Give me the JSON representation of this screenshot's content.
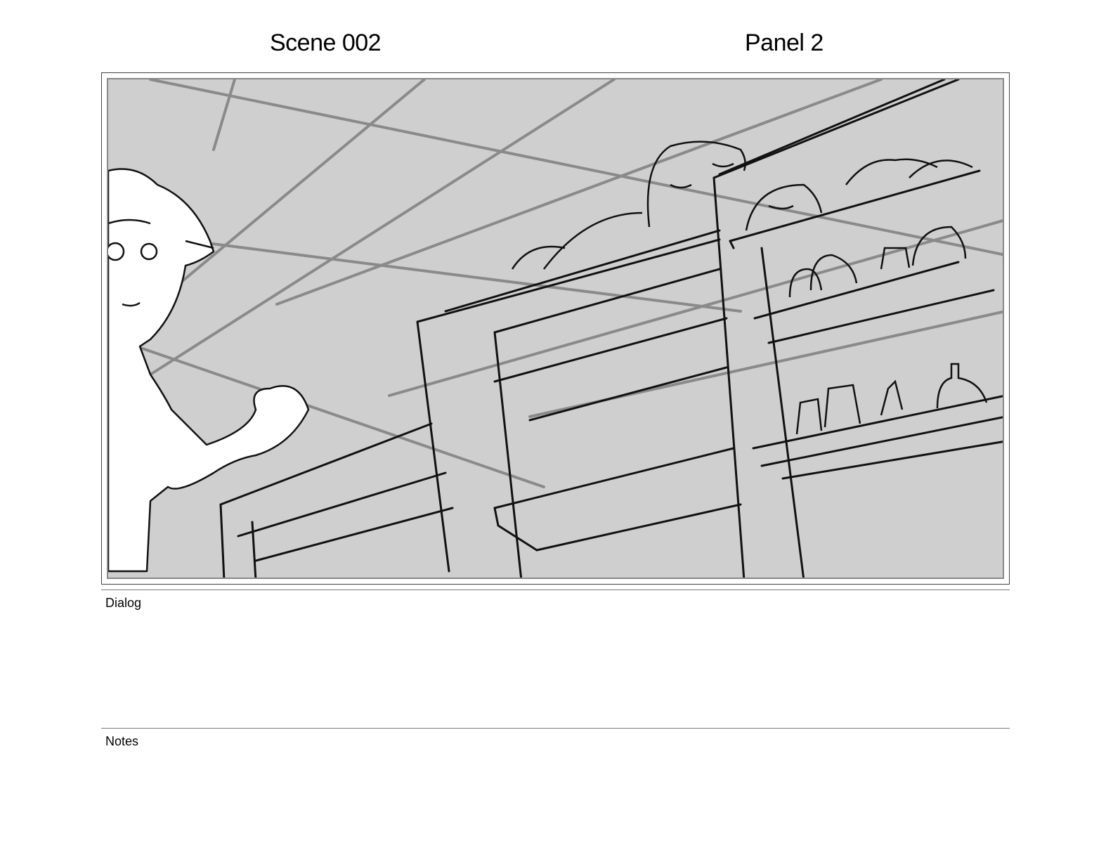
{
  "header": {
    "scene": "Scene 002",
    "panel": "Panel 2"
  },
  "panel_image": {
    "subject": "storyboard sketch: character looking up at tall shelves with creatures sleeping on top"
  },
  "sections": {
    "dialog_label": "Dialog",
    "dialog_text": "",
    "notes_label": "Notes",
    "notes_text": ""
  }
}
